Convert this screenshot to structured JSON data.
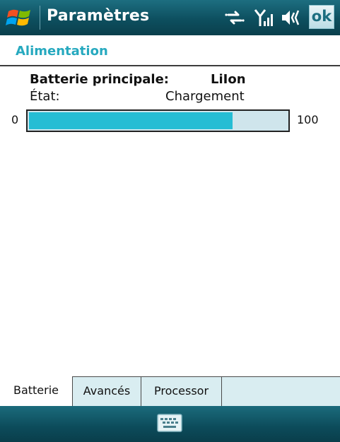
{
  "titlebar": {
    "title": "Paramètres",
    "ok_label": "ok",
    "icons": [
      "windows-start-icon",
      "connectivity-icon",
      "signal-icon",
      "volume-icon"
    ]
  },
  "section": {
    "title": "Alimentation"
  },
  "battery": {
    "label": "Batterie principale:",
    "type": "LiIon",
    "state_label": "État:",
    "state_value": "Chargement",
    "bar": {
      "min_label": "0",
      "max_label": "100",
      "level_fraction": 0.79
    }
  },
  "tabs": [
    {
      "label": "Batterie",
      "active": true
    },
    {
      "label": "Avancés",
      "active": false
    },
    {
      "label": "Processor",
      "active": false
    }
  ],
  "menubar": {
    "icon": "keyboard-icon"
  },
  "colors": {
    "titlebar": "#0d4f5f",
    "accent": "#26a9bf",
    "bar_fill": "#25bdd4",
    "bar_track": "#cfe5ec",
    "tab_bg": "#d9edf1"
  }
}
